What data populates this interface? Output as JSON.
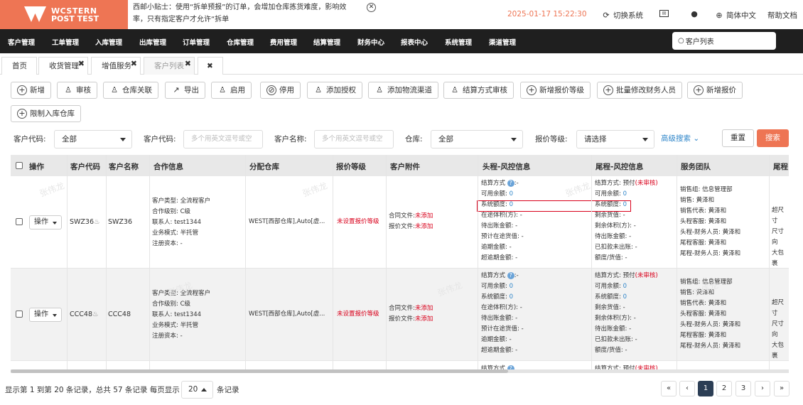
{
  "logo": {
    "line1": "WCSTERN",
    "line2": "POST TEST"
  },
  "tip": {
    "text": "西邮小贴士：使用“拆单预报”的订单，会增加仓库拣货难度，影响效率，只有指定客户才允许“拆单"
  },
  "header": {
    "datetime": "2025-01-17 15:22:30",
    "switch_system": "切换系统",
    "language": "简体中文",
    "help": "帮助文档"
  },
  "nav": {
    "items": [
      "客户管理",
      "工单管理",
      "入库管理",
      "出库管理",
      "订单管理",
      "仓库管理",
      "费用管理",
      "结算管理",
      "财务中心",
      "报表中心",
      "系统管理",
      "渠道管理"
    ],
    "search_value": "客户列表"
  },
  "tabs": [
    {
      "label": "首页"
    },
    {
      "label": "收货管理"
    },
    {
      "label": "增值服务"
    },
    {
      "label": "客户列表"
    }
  ],
  "toolbar": {
    "buttons": [
      "新增",
      "审核",
      "仓库关联",
      "导出",
      "启用",
      "停用",
      "添加授权",
      "添加物流渠道",
      "结算方式审核",
      "新增报价等级",
      "批量修改财务人员",
      "新增报价",
      "限制入库仓库"
    ]
  },
  "filters": {
    "customer_code_label": "客户代码:",
    "customer_code_select": "全部",
    "customer_code2_label": "客户代码:",
    "customer_code2_placeholder": "多个用英文逗号或空",
    "customer_name_label": "客户名称:",
    "customer_name_placeholder": "多个用英文逗号或空",
    "warehouse_label": "仓库:",
    "warehouse_select": "全部",
    "quote_level_label": "报价等级:",
    "quote_level_select": "请选择",
    "advanced": "高级搜索",
    "reset": "重置",
    "search": "搜索"
  },
  "table": {
    "headers": [
      "操作",
      "客户代码",
      "客户名称",
      "合作信息",
      "分配仓库",
      "报价等级",
      "客户附件",
      "头程-风控信息",
      "尾程-风控信息",
      "服务团队",
      "尾程"
    ],
    "rows": [
      {
        "op": "操作",
        "code": "SWZ36",
        "name": "SWZ36",
        "coop": [
          "客户类型: 全流程客户",
          "合作级别: C级",
          "联系人: test1344",
          "业务模式: 半托管",
          "注册资本: -"
        ],
        "warehouse": "WEST[西部仓库],Auto[虚...",
        "quote": "未设置报价等级",
        "attach1_label": "合同文件:",
        "attach1_val": "未添加",
        "attach2_label": "报价文件:",
        "attach2_val": "未添加",
        "head_risk": [
          "结算方式",
          "可用余额:",
          "系统额度:",
          "在途体积(方):",
          "待出账金额:",
          "预计在途货值:",
          "逾期金额:",
          "超逾期金额:"
        ],
        "head_vals": [
          ":-",
          "0",
          "0",
          "-",
          "-",
          "-",
          "-",
          "-"
        ],
        "tail_risk": [
          "结算方式: 预付",
          "可用余额:",
          "系统额度:",
          "剩余货值:",
          "剩余体积(方):",
          "待出账金额:",
          "已扣款未出账:",
          "额度/货值:"
        ],
        "tail_vals": [
          "(未审核)",
          "0",
          "0",
          "-",
          "-",
          "-",
          "-",
          "-"
        ],
        "team": [
          "销售组: 信息管理部",
          "销售: 黄泽和",
          "销售代表: 黄泽和",
          "头程客服: 黄泽和",
          "头程-财务人员: 黄泽和",
          "尾程客服: 黄泽和",
          "尾程-财务人员: 黄泽和"
        ],
        "tail_col": [
          "超尺寸",
          "尺寸向",
          "大包裹"
        ]
      },
      {
        "op": "操作",
        "code": "CCC48",
        "name": "CCC48",
        "coop": [
          "客户类型: 全流程客户",
          "合作级别: C级",
          "联系人: test1344",
          "业务模式: 半托管",
          "注册资本: -"
        ],
        "warehouse": "WEST[西部仓库],Auto[虚...",
        "quote": "未设置报价等级",
        "attach1_label": "合同文件:",
        "attach1_val": "未添加",
        "attach2_label": "报价文件:",
        "attach2_val": "未添加",
        "head_risk": [
          "结算方式",
          "可用余额:",
          "系统额度:",
          "在途体积(方):",
          "待出账金额:",
          "预计在途货值:",
          "逾期金额:",
          "超逾期金额:"
        ],
        "head_vals": [
          ":-",
          "0",
          "0",
          "-",
          "-",
          "-",
          "-",
          "-"
        ],
        "tail_risk": [
          "结算方式: 预付",
          "可用余额:",
          "系统额度:",
          "剩余货值:",
          "剩余体积(方):",
          "待出账金额:",
          "已扣款未出账:",
          "额度/货值:"
        ],
        "tail_vals": [
          "(未审核)",
          "0",
          "0",
          "-",
          "-",
          "-",
          "-",
          "-"
        ],
        "team": [
          "销售组: 信息管理部",
          "销售: 黄泽和",
          "销售代表: 黄泽和",
          "头程客服: 黄泽和",
          "头程-财务人员: 黄泽和",
          "尾程客服: 黄泽和",
          "尾程-财务人员: 黄泽和"
        ],
        "tail_col": [
          "超尺寸",
          "尺寸向",
          "大包裹"
        ]
      }
    ],
    "partial_row": {
      "head": "结算方式",
      "tail": "结算方式: 预付",
      "tail_status": "(未审核)"
    }
  },
  "footer": {
    "summary": "显示第 1 到第 20 条记录，总共 57 条记录 每页显示",
    "page_size": "20",
    "suffix": "条记录",
    "pages": [
      "«",
      "‹",
      "1",
      "2",
      "3",
      "›",
      "»"
    ]
  },
  "watermark": "张伟龙",
  "colors": {
    "brand": "#ee7554",
    "nav_bg": "#1f1f1f",
    "danger": "#d9001b",
    "link": "#2f86c9"
  }
}
